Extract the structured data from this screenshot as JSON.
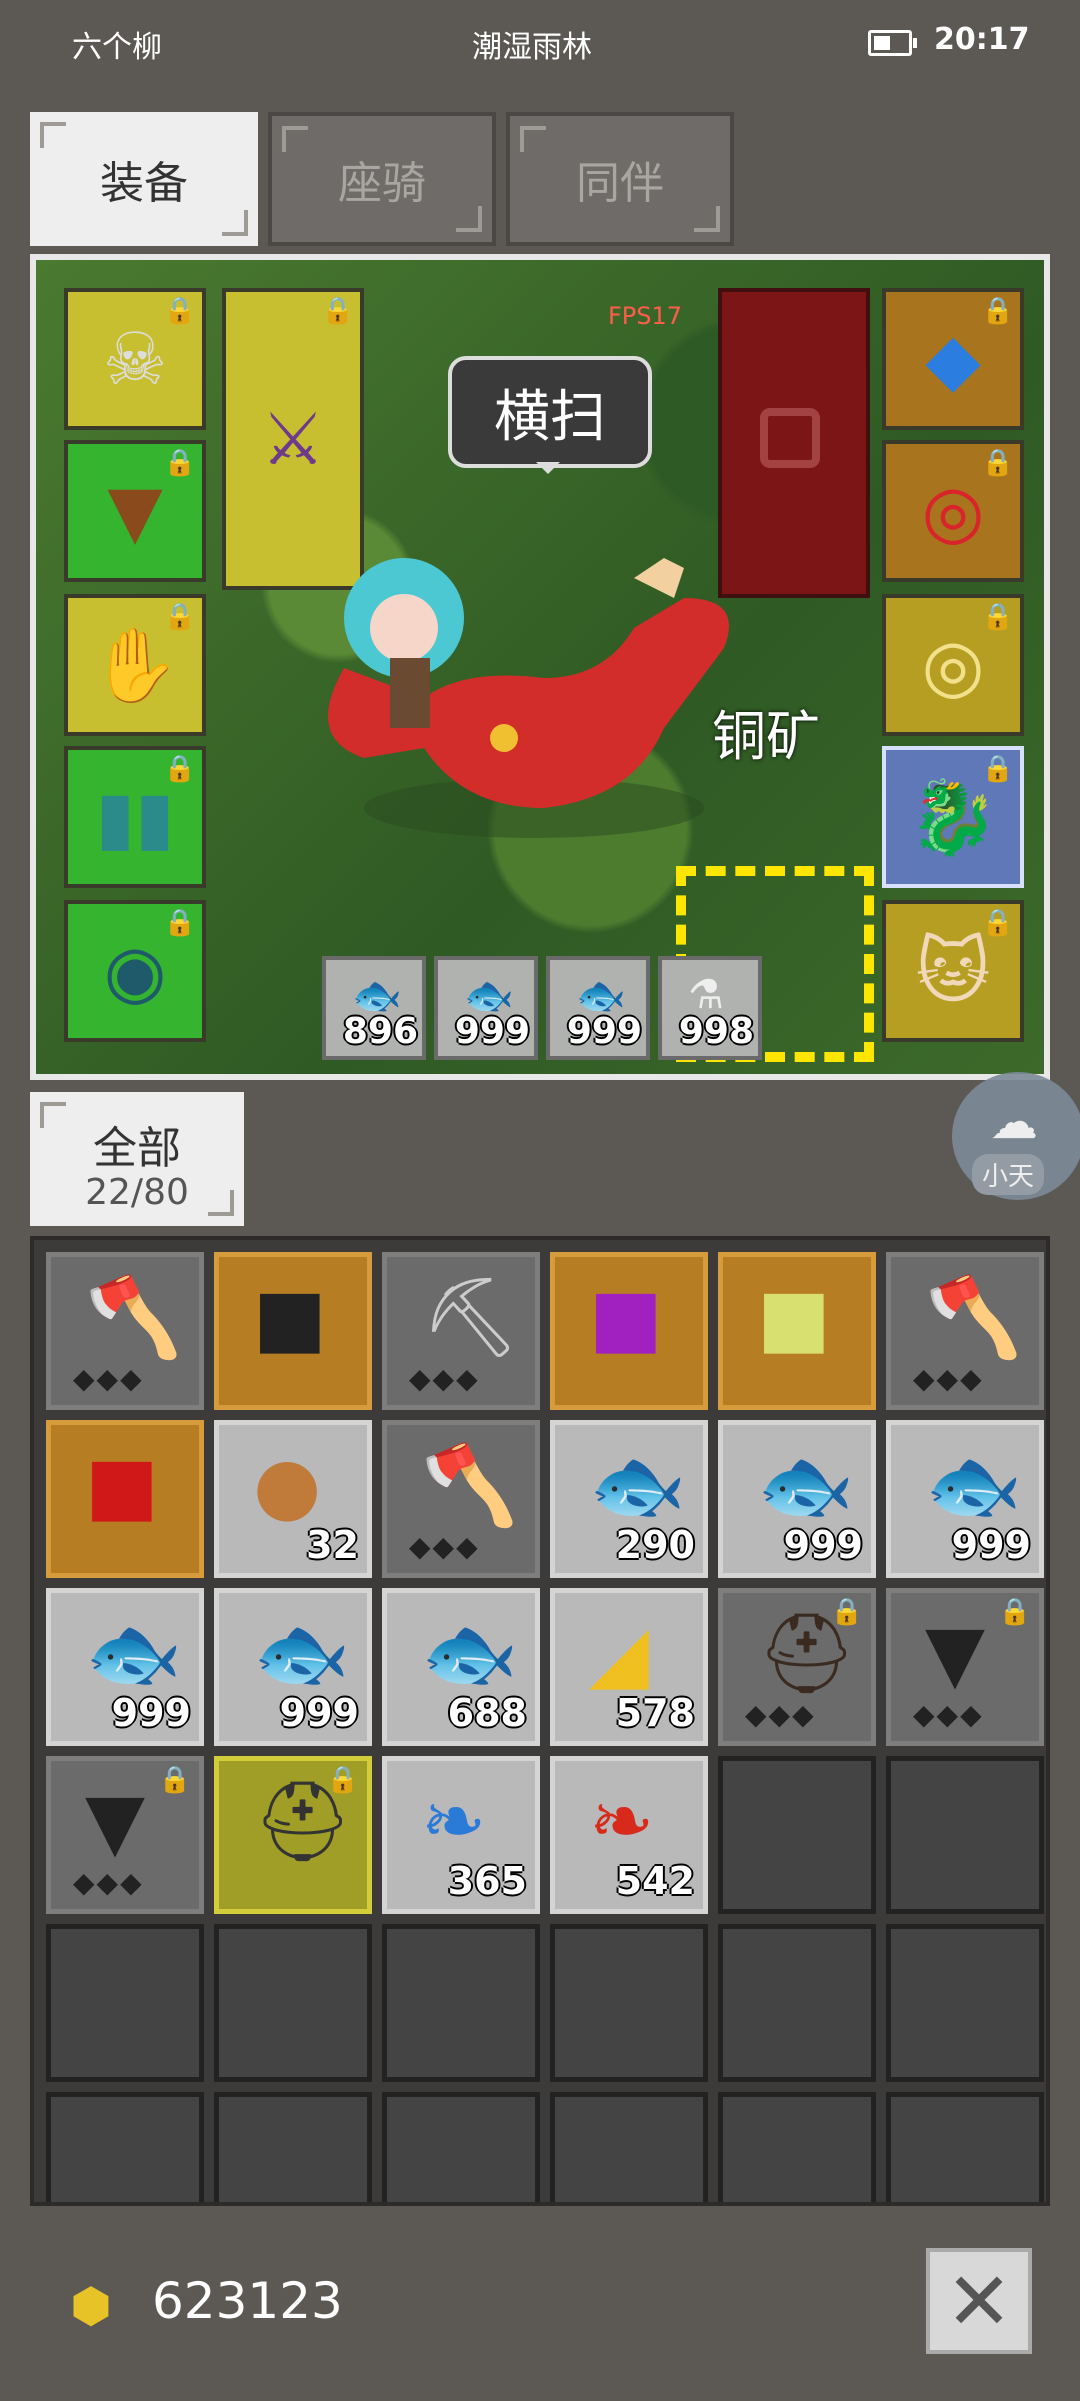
{
  "status_bar": {
    "carrier": "六个柳",
    "location": "潮湿雨林",
    "time": "20:17"
  },
  "tabs": [
    "装备",
    "座骑",
    "同伴"
  ],
  "game_view": {
    "fps": "FPS17",
    "skill_bubble": "横扫",
    "resource_label": "铜矿",
    "quick_slots": [
      "896",
      "999",
      "999",
      "998"
    ]
  },
  "assistant": {
    "name": "小天"
  },
  "category": {
    "name": "全部",
    "capacity": "22/80"
  },
  "inventory_counts": {
    "ore": "32",
    "fish1": "290",
    "fish2": "999",
    "fish3": "999",
    "fish4": "999",
    "fish5": "999",
    "fish6": "688",
    "cheese": "578",
    "blue_feather": "365",
    "red_feather": "542"
  },
  "gold": "623123",
  "colors": {
    "active_tab": "#eeeeee",
    "background": "#5c5955",
    "accent_gold": "#e8c327"
  }
}
